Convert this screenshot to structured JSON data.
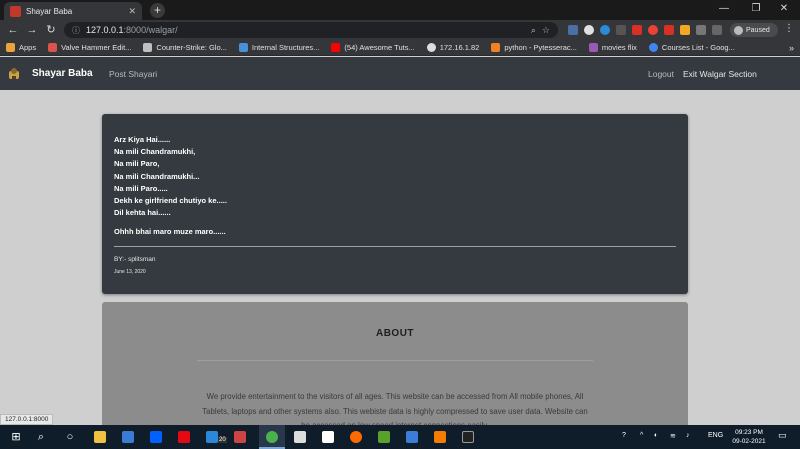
{
  "browser": {
    "tab_title": "Shayar Baba",
    "tab_close": "✕",
    "newtab": "+",
    "window_controls": {
      "minimize": "—",
      "restore": "❐",
      "close": "✕"
    },
    "nav": {
      "back": "←",
      "forward": "→",
      "reload": "↻"
    },
    "url_host": "127.0.0.1",
    "url_rest": ":8000/walgar/",
    "profile_status": "Paused",
    "bookmarks": [
      {
        "label": "Apps",
        "color": "#e8a33a"
      },
      {
        "label": "Valve Hammer Edit...",
        "color": "#d9534f"
      },
      {
        "label": "Counter-Strike: Glo...",
        "color": "#bfbfbf"
      },
      {
        "label": "Internal Structures...",
        "color": "#4a90d9"
      },
      {
        "label": "(54) Awesome Tuts...",
        "color": "#ff0000"
      },
      {
        "label": "172.16.1.82",
        "color": "#dddddd"
      },
      {
        "label": "python - Pytesserac...",
        "color": "#f48024"
      },
      {
        "label": "movies flix",
        "color": "#9b59b6"
      },
      {
        "label": "Courses List - Goog...",
        "color": "#4285f4"
      }
    ],
    "bookmarks_more": "»",
    "status_url": "127.0.0.1:8000"
  },
  "navbar": {
    "brand": "Shayar Baba",
    "post_link": "Post Shayari",
    "logout_link": "Logout",
    "exit_link": "Exit Walgar Section"
  },
  "post": {
    "lines": [
      "Arz Kiya Hai......",
      "Na mili Chandramukhi,",
      "Na mili Paro,",
      "Na mili Chandramukhi...",
      "Na mili Paro.....",
      "Dekh ke girlfriend chutiyo ke.....",
      "Dil kehta hai......"
    ],
    "punchline": "Ohhh bhai maro muze maro......",
    "author": "BY:- splitsman",
    "date": "June 13, 2020"
  },
  "about": {
    "heading": "ABOUT",
    "text": "We provide entertainment to the visitors of all ages. This website can be accessed from All mobile phones, All Tablets, laptops and other systems also. This webiste data is highly compressed to save user data. Website can be accessed on low speed internet connections easily."
  },
  "taskbar": {
    "notification_count": "20",
    "lang": "ENG",
    "time": "09:23 PM",
    "date": "09-02-2021"
  },
  "colors": {
    "navbar": "#343a40",
    "card": "#343a40",
    "about": "#8c8c8c",
    "page": "#cfcfcf"
  }
}
